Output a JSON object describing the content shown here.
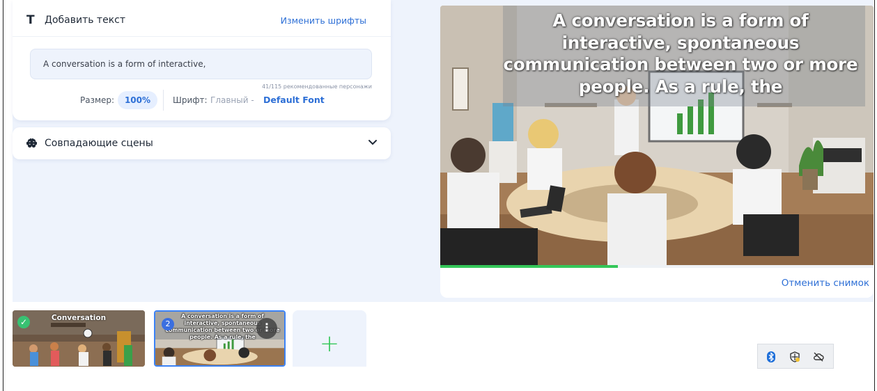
{
  "text_panel": {
    "title": "Добавить текст",
    "title_icon": "T",
    "change_fonts_link": "Изменить шрифты",
    "text_value": "A conversation is a form of interactive,",
    "counter": "41/115 рекомендованные персонажи",
    "size_label": "Размер:",
    "size_value": "100%",
    "font_label": "Шрифт:",
    "font_value": "Главный -",
    "font_name": "Default Font"
  },
  "scenes_panel": {
    "title": "Совпадающие сцены",
    "icon": "brain-icon"
  },
  "preview": {
    "caption": "A conversation is a form of interactive, spontaneous communication between two or more people. As a rule, the",
    "progress_percent": 41,
    "cancel_snapshot": "Отменить снимок"
  },
  "timeline": {
    "scenes": [
      {
        "title": "Conversation",
        "status_icon": "check-icon"
      },
      {
        "number": "2",
        "caption": "A conversation is a form of interactive, spontaneous communication between two or more people. As a rule, the",
        "menu_icon": "more-vertical-icon"
      }
    ],
    "add_icon": "plus-icon"
  },
  "system_tray": {
    "icons": [
      "bluetooth-icon",
      "security-shield-icon",
      "cloud-off-icon"
    ]
  },
  "colors": {
    "accent": "#2d6fd6",
    "progress": "#34c759",
    "panel_bg": "#eef3fc"
  }
}
